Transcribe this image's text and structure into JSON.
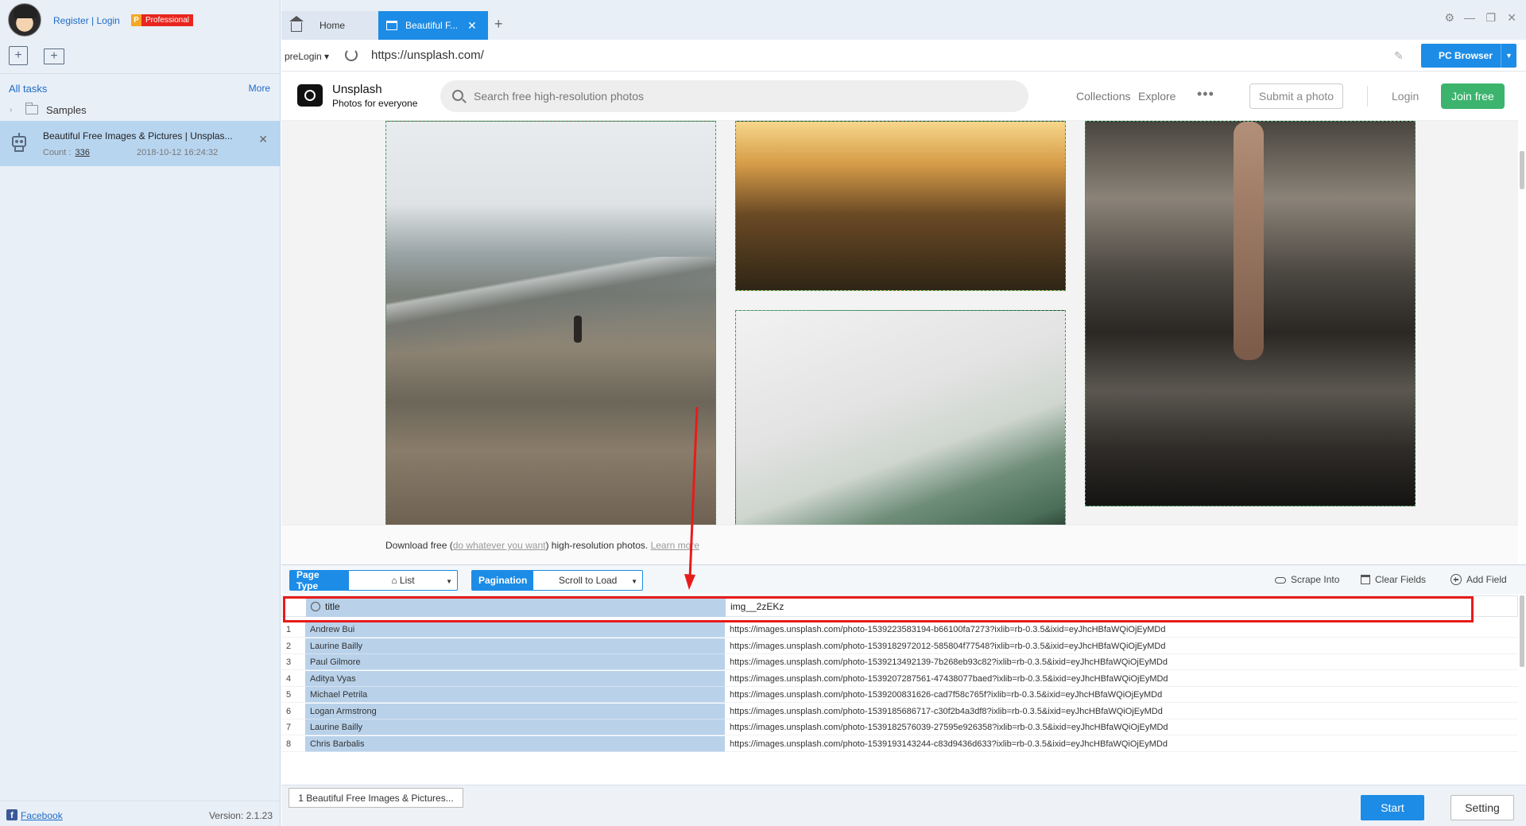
{
  "sidebar": {
    "register_login": "Register | Login",
    "pro_badge_letter": "P",
    "pro_badge_text": "Professional",
    "all_tasks": "All tasks",
    "more": "More",
    "samples": "Samples",
    "task": {
      "title": "Beautiful Free Images & Pictures | Unsplas...",
      "count_label": "Count :",
      "count_value": "336",
      "date": "2018-10-12 16:24:32"
    },
    "facebook": "Facebook",
    "version": "Version: 2.1.23"
  },
  "tabs": {
    "home": "Home",
    "active": "Beautiful F..."
  },
  "address_bar": {
    "prelogin": "preLogin",
    "url": "https://unsplash.com/",
    "pc_browser": "PC Browser"
  },
  "website": {
    "brand": "Unsplash",
    "tagline": "Photos for everyone",
    "search_placeholder": "Search free high-resolution photos",
    "nav": {
      "collections": "Collections",
      "explore": "Explore",
      "more": "•••"
    },
    "submit_photo": "Submit a photo",
    "login": "Login",
    "join_free": "Join free",
    "download_prefix": "Download free (",
    "download_link": "do whatever you want",
    "download_suffix": ") high-resolution photos.",
    "learn_more": "Learn more"
  },
  "panel": {
    "page_type_label": "Page Type",
    "page_type_value": "List",
    "pagination_label": "Pagination",
    "pagination_value": "Scroll to Load",
    "scrape_into": "Scrape Into",
    "clear_fields": "Clear Fields",
    "add_field": "Add Field",
    "columns": {
      "title": "title",
      "img": "img__2zEKz"
    },
    "rows": [
      {
        "idx": "1",
        "name": "Andrew Bui",
        "img": "https://images.unsplash.com/photo-1539223583194-b66100fa7273?ixlib=rb-0.3.5&ixid=eyJhcHBfaWQiOjEyMDd"
      },
      {
        "idx": "2",
        "name": "Laurine Bailly",
        "img": "https://images.unsplash.com/photo-1539182972012-585804f77548?ixlib=rb-0.3.5&ixid=eyJhcHBfaWQiOjEyMDd"
      },
      {
        "idx": "3",
        "name": "Paul Gilmore",
        "img": "https://images.unsplash.com/photo-1539213492139-7b268eb93c82?ixlib=rb-0.3.5&ixid=eyJhcHBfaWQiOjEyMDd"
      },
      {
        "idx": "4",
        "name": "Aditya Vyas",
        "img": "https://images.unsplash.com/photo-1539207287561-47438077baed?ixlib=rb-0.3.5&ixid=eyJhcHBfaWQiOjEyMDd"
      },
      {
        "idx": "5",
        "name": "Michael Petrila",
        "img": "https://images.unsplash.com/photo-1539200831626-cad7f58c765f?ixlib=rb-0.3.5&ixid=eyJhcHBfaWQiOjEyMDd"
      },
      {
        "idx": "6",
        "name": "Logan Armstrong",
        "img": "https://images.unsplash.com/photo-1539185686717-c30f2b4a3df8?ixlib=rb-0.3.5&ixid=eyJhcHBfaWQiOjEyMDd"
      },
      {
        "idx": "7",
        "name": "Laurine Bailly",
        "img": "https://images.unsplash.com/photo-1539182576039-27595e926358?ixlib=rb-0.3.5&ixid=eyJhcHBfaWQiOjEyMDd"
      },
      {
        "idx": "8",
        "name": "Chris Barbalis",
        "img": "https://images.unsplash.com/photo-1539193143244-c83d9436d633?ixlib=rb-0.3.5&ixid=eyJhcHBfaWQiOjEyMDd"
      }
    ],
    "sheet_tab": "1 Beautiful Free Images & Pictures...",
    "start": "Start",
    "setting": "Setting"
  },
  "colors": {
    "accent": "#1c8ce6",
    "annotation": "#e81b1b",
    "join_green": "#3cb46e",
    "selection": "#b9d2ea"
  }
}
